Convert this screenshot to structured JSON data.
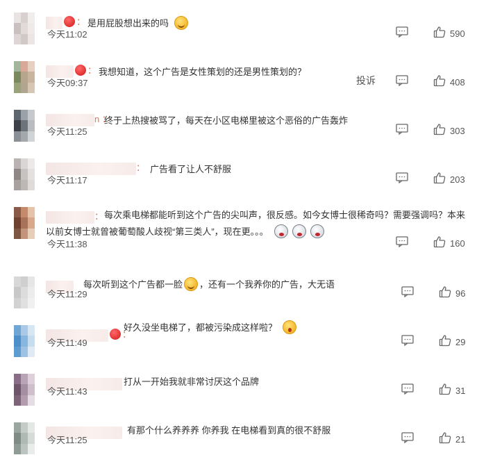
{
  "colors": {
    "username": "#eb7350",
    "text": "#333333",
    "meta": "#555555"
  },
  "icons": {
    "comment": "comment-bubble-icon",
    "like": "thumbs-up-icon",
    "emoji": "face-emoji-icon"
  },
  "comments": [
    {
      "username_suffix": "：",
      "text_a": "是用屁股想出来的吗",
      "text_b": "",
      "emoji_mid": "",
      "emoji_end": "smirk",
      "time": "今天11:02",
      "likes": "590",
      "report": ""
    },
    {
      "username_suffix": "：",
      "text_a": "我想知道，这个广告是女性策划的还是男性策划的？",
      "text_b": "",
      "emoji_mid": "",
      "emoji_end": "",
      "time": "今天09:37",
      "likes": "408",
      "report": "投诉"
    },
    {
      "username_suffix": "n ：",
      "text_a": "终于上热搜被骂了，每天在小区电梯里被这个恶俗的广告轰炸",
      "text_b": "",
      "emoji_mid": "",
      "emoji_end": "",
      "time": "今天11:25",
      "likes": "303",
      "report": ""
    },
    {
      "username_suffix": "：",
      "text_a": "广告看了让人不舒服",
      "text_b": "",
      "emoji_mid": "",
      "emoji_end": "",
      "time": "今天11:17",
      "likes": "203",
      "report": ""
    },
    {
      "username_suffix": "：",
      "text_a": "每次乘电梯都能听到这个广告的尖叫声，很反感。如今女博士很稀奇吗？需要强调吗？本来",
      "text_b": "以前女博士就曾被葡萄酸人歧视“第三类人”，现在更。。。",
      "emoji_mid": "",
      "emoji_end": "cry",
      "time": "今天11:38",
      "likes": "160",
      "report": ""
    },
    {
      "username_suffix": "",
      "text_a": "每次听到这个广告都一脸",
      "text_b": "，还有一个我养你的广告，大无语",
      "emoji_mid": "smirk",
      "emoji_end": "",
      "time": "今天11:29",
      "likes": "96",
      "report": ""
    },
    {
      "username_suffix": "：",
      "text_a": "好久没坐电梯了，都被污染成这样啦？",
      "text_b": "",
      "emoji_mid": "",
      "emoji_end": "shock",
      "time": "今天11:49",
      "likes": "29",
      "report": ""
    },
    {
      "username_suffix": "",
      "text_a": "打从一开始我就非常讨厌这个品牌",
      "text_b": "",
      "emoji_mid": "",
      "emoji_end": "",
      "time": "今天11:43",
      "likes": "31",
      "report": ""
    },
    {
      "username_suffix": "",
      "text_a": "有那个什么养养养 你养我 在电梯看到真的很不舒服",
      "text_b": "",
      "emoji_mid": "",
      "emoji_end": "",
      "time": "今天11:25",
      "likes": "21",
      "report": ""
    }
  ]
}
